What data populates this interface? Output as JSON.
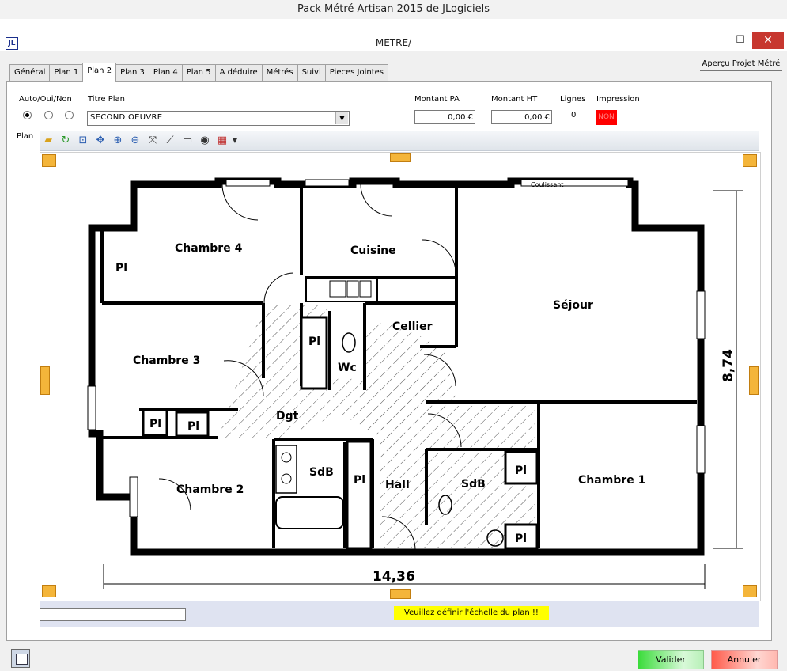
{
  "app": {
    "title": "Pack Métré Artisan 2015 de JLogiciels",
    "logo": "JL"
  },
  "window": {
    "title": "METRE/",
    "minimize": "—",
    "maximize": "☐",
    "close": "✕"
  },
  "apercu_button": "Aperçu Projet Métré",
  "tabs": [
    "Général",
    "Plan 1",
    "Plan 2",
    "Plan 3",
    "Plan 4",
    "Plan 5",
    "A déduire",
    "Métrés",
    "Suivi",
    "Pieces Jointes"
  ],
  "active_tab": "Plan 2",
  "form": {
    "auto_label": "Auto/Oui/Non",
    "titre_plan_label": "Titre Plan",
    "titre_plan_value": "SECOND OEUVRE",
    "montant_pa_label": "Montant PA",
    "montant_pa_value": "0,00",
    "montant_ht_label": "Montant HT",
    "montant_ht_value": "0,00",
    "currency": "€",
    "lignes_label": "Lignes",
    "lignes_value": "0",
    "impression_label": "Impression",
    "impression_value": "NON",
    "plan_label": "Plan"
  },
  "toolbar_icons": [
    "open-folder-icon",
    "refresh-icon",
    "fit-page-icon",
    "move-icon",
    "zoom-in-icon",
    "zoom-out-icon",
    "full-extent-icon",
    "ruler-icon",
    "select-area-icon",
    "eye-icon",
    "color-grid-icon"
  ],
  "floorplan": {
    "rooms": [
      "Chambre 4",
      "Cuisine",
      "Séjour",
      "Cellier",
      "Chambre 3",
      "Pl",
      "Wc",
      "Dgt",
      "Chambre 2",
      "SdB",
      "Hall",
      "Chambre 1"
    ],
    "coulissant": "Coulissant",
    "width_dim": "14,36",
    "height_dim": "8,74"
  },
  "status": {
    "warning": "Veuillez définir l'échelle du plan !!"
  },
  "buttons": {
    "valider": "Valider",
    "annuler": "Annuler"
  }
}
